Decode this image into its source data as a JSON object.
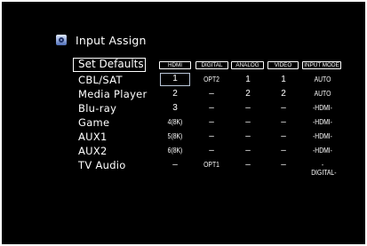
{
  "title": {
    "text": "Input Assign",
    "icon": "input-icon"
  },
  "set_defaults": "Set Defaults",
  "headers": [
    "HDMI",
    "DIGITAL",
    "ANALOG",
    "VIDEO",
    "INPUT MODE"
  ],
  "rows": [
    {
      "label": "CBL/SAT",
      "hdmi": "1",
      "digital": "OPT2",
      "analog": "1",
      "video": "1",
      "mode": "AUTO"
    },
    {
      "label": "Media Player",
      "hdmi": "2",
      "digital": "–",
      "analog": "2",
      "video": "2",
      "mode": "AUTO"
    },
    {
      "label": "Blu-ray",
      "hdmi": "3",
      "digital": "–",
      "analog": "–",
      "video": "–",
      "mode": "-HDMI-"
    },
    {
      "label": "Game",
      "hdmi": "4(8K)",
      "digital": "–",
      "analog": "–",
      "video": "–",
      "mode": "-HDMI-"
    },
    {
      "label": "AUX1",
      "hdmi": "5(8K)",
      "digital": "–",
      "analog": "–",
      "video": "–",
      "mode": "-HDMI-"
    },
    {
      "label": "AUX2",
      "hdmi": "6(8K)",
      "digital": "–",
      "analog": "–",
      "video": "–",
      "mode": "-HDMI-"
    },
    {
      "label": "TV Audio",
      "hdmi": "–",
      "digital": "OPT1",
      "analog": "–",
      "video": "–",
      "mode": "-DIGITAL-"
    }
  ],
  "colors": {
    "background": "#000000",
    "text": "#ffffff",
    "selection": "#b9c6d8"
  }
}
